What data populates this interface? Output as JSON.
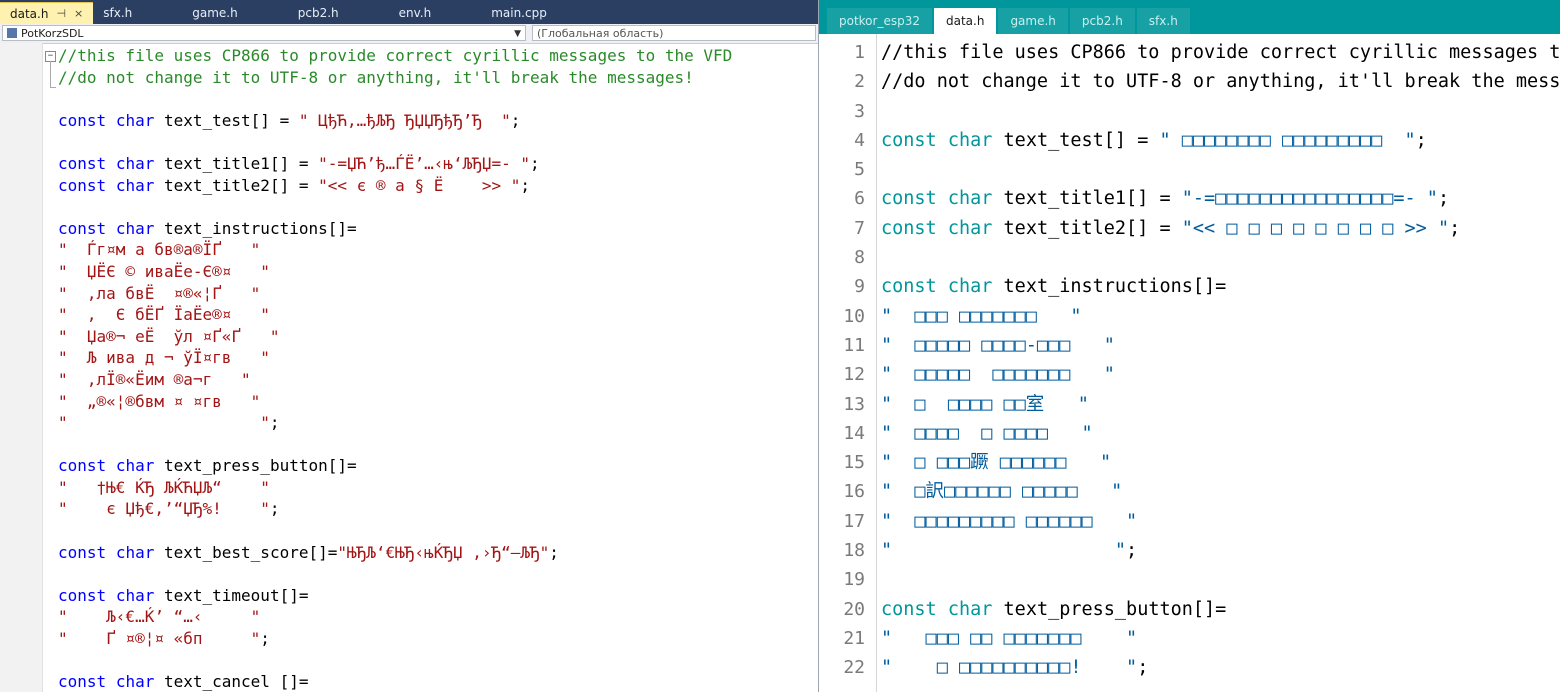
{
  "vs": {
    "tabs": [
      "data.h",
      "sfx.h",
      "game.h",
      "pcb2.h",
      "env.h",
      "main.cpp"
    ],
    "active_tab_pin": "⊣",
    "active_tab_close": "×",
    "nav_scope_left": "PotKorzSDL",
    "nav_scope_right": "(Глобальная область)",
    "lines": [
      [
        [
          "c",
          "//this file uses CP866 to provide correct cyrillic messages to the VFD"
        ]
      ],
      [
        [
          "c",
          "//do not change it to UTF-8 or anything, it'll break the messages!"
        ]
      ],
      [],
      [
        [
          "k",
          "const"
        ],
        [
          "p",
          " "
        ],
        [
          "k",
          "char"
        ],
        [
          "p",
          " text_test[] = "
        ],
        [
          "s",
          "\" ЦђЋ‚…ђЉЂ ЂЏЏЂђЂ’Ђ  \""
        ],
        [
          "p",
          ";"
        ]
      ],
      [],
      [
        [
          "k",
          "const"
        ],
        [
          "p",
          " "
        ],
        [
          "k",
          "char"
        ],
        [
          "p",
          " text_title1[] = "
        ],
        [
          "s",
          "\"-=ЏЋ’ђ…ЃЁ’…‹њ‘ЉЂЏ=- \""
        ],
        [
          "p",
          ";"
        ]
      ],
      [
        [
          "k",
          "const"
        ],
        [
          "p",
          " "
        ],
        [
          "k",
          "char"
        ],
        [
          "p",
          " text_title2[] = "
        ],
        [
          "s",
          "\"<< є ® а § Ё    >> \""
        ],
        [
          "p",
          ";"
        ]
      ],
      [],
      [
        [
          "k",
          "const"
        ],
        [
          "p",
          " "
        ],
        [
          "k",
          "char"
        ],
        [
          "p",
          " text_instructions[]="
        ]
      ],
      [
        [
          "s",
          "\"  Ѓг¤м а бв®а®ЇҐ   \""
        ]
      ],
      [
        [
          "s",
          "\"  ЏЁЄ © иваЁе-Є®¤   \""
        ]
      ],
      [
        [
          "s",
          "\"  ‚ла бвЁ  ¤®«¦Ґ   \""
        ]
      ],
      [
        [
          "s",
          "\"  ‚  Є бЁҐ ЇаЁе®¤   \""
        ]
      ],
      [
        [
          "s",
          "\"  Џа®¬ еЁ  ўл ¤Ґ«Ґ   \""
        ]
      ],
      [
        [
          "s",
          "\"  Љ ива д ¬ ўЇ¤гв   \""
        ]
      ],
      [
        [
          "s",
          "\"  ‚лЇ®«Ёим ®а¬г   \""
        ]
      ],
      [
        [
          "s",
          "\"  „®«¦®бвм ¤ ¤гв   \""
        ]
      ],
      [
        [
          "s",
          "\"                    \""
        ],
        [
          "p",
          ";"
        ]
      ],
      [],
      [
        [
          "k",
          "const"
        ],
        [
          "p",
          " "
        ],
        [
          "k",
          "char"
        ],
        [
          "p",
          " text_press_button[]="
        ]
      ],
      [
        [
          "s",
          "\"   †Њ€ ЌЂ ЉЌЋЏЉ“    \""
        ]
      ],
      [
        [
          "s",
          "\"    є Џђ€‚’“ЏЂ%!    \""
        ],
        [
          "p",
          ";"
        ]
      ],
      [],
      [
        [
          "k",
          "const"
        ],
        [
          "p",
          " "
        ],
        [
          "k",
          "char"
        ],
        [
          "p",
          " text_best_score[]="
        ],
        [
          "s",
          "\"ЊЂЉ‘€ЊЂ‹њЌЂЏ ‚›Ђ“—ЉЂ\""
        ],
        [
          "p",
          ";"
        ]
      ],
      [],
      [
        [
          "k",
          "const"
        ],
        [
          "p",
          " "
        ],
        [
          "k",
          "char"
        ],
        [
          "p",
          " text_timeout[]="
        ]
      ],
      [
        [
          "s",
          "\"    Љ‹€…Ќ’ “…‹     \""
        ]
      ],
      [
        [
          "s",
          "\"    Ґ ¤®¦¤ «бп     \""
        ],
        [
          "p",
          ";"
        ]
      ],
      [],
      [
        [
          "k",
          "const"
        ],
        [
          "p",
          " "
        ],
        [
          "k",
          "char"
        ],
        [
          "p",
          " text_cancel []="
        ]
      ]
    ]
  },
  "arduino": {
    "tabs": [
      "potkor_esp32",
      "data.h",
      "game.h",
      "pcb2.h",
      "sfx.h"
    ],
    "active_index": 1,
    "line_numbers": [
      "1",
      "2",
      "3",
      "4",
      "5",
      "6",
      "7",
      "8",
      "9",
      "10",
      "11",
      "12",
      "13",
      "14",
      "15",
      "16",
      "17",
      "18",
      "19",
      "20",
      "21",
      "22"
    ],
    "lines": [
      [
        [
          "ap",
          "//this file uses CP866 to provide correct cyrillic messages to the VFD"
        ]
      ],
      [
        [
          "ap",
          "//do not change it to UTF-8 or anything, it'll break the messages!"
        ]
      ],
      [],
      [
        [
          "ak",
          "const"
        ],
        [
          "ap",
          " "
        ],
        [
          "ak",
          "char"
        ],
        [
          "ap",
          " text_test[] = "
        ],
        [
          "as",
          "\" □□□□□□□□ □□□□□□□□□  \""
        ],
        [
          "ap",
          ";"
        ]
      ],
      [],
      [
        [
          "ak",
          "const"
        ],
        [
          "ap",
          " "
        ],
        [
          "ak",
          "char"
        ],
        [
          "ap",
          " text_title1[] = "
        ],
        [
          "as",
          "\"-=□□□□□□□□□□□□□□□□=- \""
        ],
        [
          "ap",
          ";"
        ]
      ],
      [
        [
          "ak",
          "const"
        ],
        [
          "ap",
          " "
        ],
        [
          "ak",
          "char"
        ],
        [
          "ap",
          " text_title2[] = "
        ],
        [
          "as",
          "\"<< □ □ □ □ □ □ □ □ >> \""
        ],
        [
          "ap",
          ";"
        ]
      ],
      [],
      [
        [
          "ak",
          "const"
        ],
        [
          "ap",
          " "
        ],
        [
          "ak",
          "char"
        ],
        [
          "ap",
          " text_instructions[]="
        ]
      ],
      [
        [
          "as",
          "\"  □□□ □□□□□□□   \""
        ]
      ],
      [
        [
          "as",
          "\"  □□□□□ □□□□-□□□   \""
        ]
      ],
      [
        [
          "as",
          "\"  □□□□□  □□□□□□□   \""
        ]
      ],
      [
        [
          "as",
          "\"  □  □□□□ □□室   \""
        ]
      ],
      [
        [
          "as",
          "\"  □□□□  □ □□□□   \""
        ]
      ],
      [
        [
          "as",
          "\"  □ □□□蹶 □□□□□□   \""
        ]
      ],
      [
        [
          "as",
          "\"  □訳□□□□□□ □□□□□   \""
        ]
      ],
      [
        [
          "as",
          "\"  □□□□□□□□□ □□□□□□   \""
        ]
      ],
      [
        [
          "as",
          "\"                    \""
        ],
        [
          "ap",
          ";"
        ]
      ],
      [],
      [
        [
          "ak",
          "const"
        ],
        [
          "ap",
          " "
        ],
        [
          "ak",
          "char"
        ],
        [
          "ap",
          " text_press_button[]="
        ]
      ],
      [
        [
          "as",
          "\"   □□□ □□ □□□□□□□    \""
        ]
      ],
      [
        [
          "as",
          "\"    □ □□□□□□□□□□!    \""
        ],
        [
          "ap",
          ";"
        ]
      ]
    ]
  }
}
